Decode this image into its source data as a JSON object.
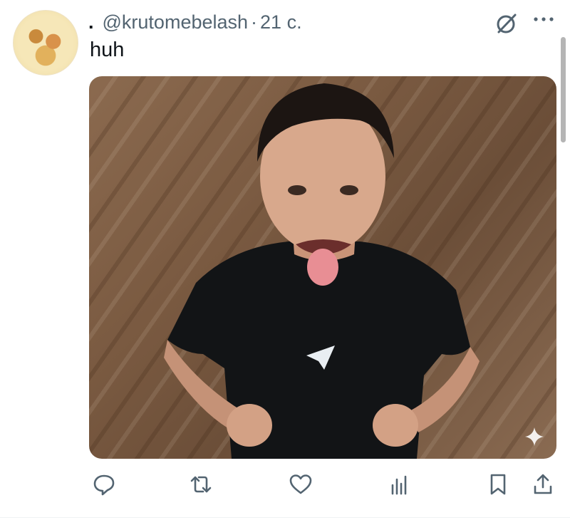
{
  "tweet": {
    "lead_dot": ".",
    "handle": "@krutomebelash",
    "separator": "·",
    "time": "21 с.",
    "text": "huh"
  },
  "icons": {
    "grok": "grok-icon",
    "more": "more-horizontal-icon",
    "sparkle": "sparkle-icon",
    "reply": "reply-icon",
    "retweet": "retweet-icon",
    "like": "heart-icon",
    "views": "bar-chart-icon",
    "bookmark": "bookmark-icon",
    "share": "share-icon"
  },
  "colors": {
    "text": "#0f1419",
    "secondary": "#536471",
    "icon": "#536471"
  }
}
